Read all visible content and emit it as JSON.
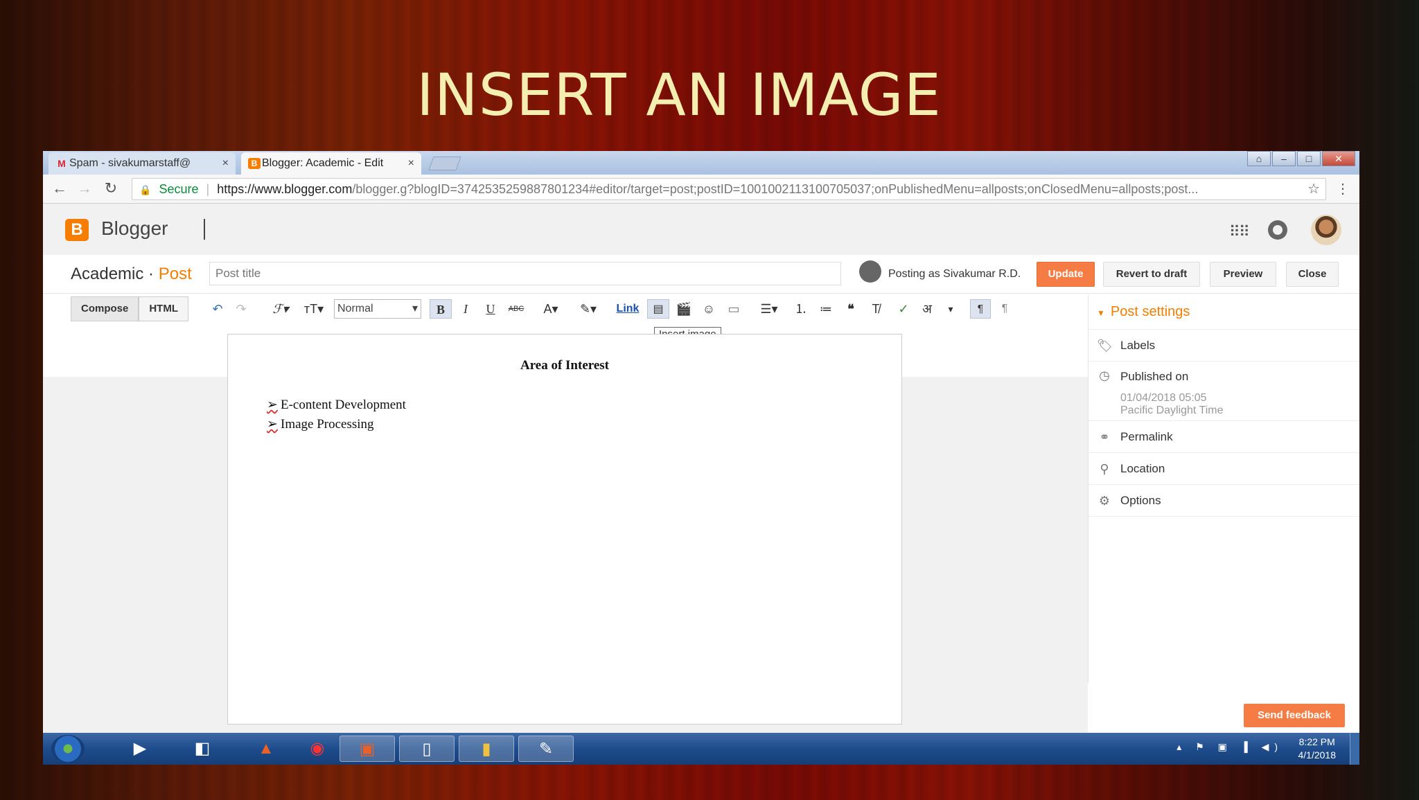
{
  "slide": {
    "title": "INSERT AN IMAGE"
  },
  "browser": {
    "tabs": [
      {
        "label": "Spam - sivakumarstaff@",
        "icon": "gmail-icon"
      },
      {
        "label": "Blogger: Academic - Edit",
        "icon": "blogger-icon"
      }
    ],
    "tab_close": "×",
    "address": {
      "secure_label": "Secure",
      "url_host": "https://www.blogger.com",
      "url_rest": "/blogger.g?blogID=3742535259887801234#editor/target=post;postID=1001002113100705037;onPublishedMenu=allposts;onClosedMenu=allposts;post..."
    }
  },
  "blogger": {
    "brand": "Blogger",
    "logo_letter": "B",
    "crumb_blog": "Academic",
    "crumb_sep": "·",
    "crumb_post": "Post",
    "post_title_placeholder": "Post title",
    "posting_as_prefix": "Posting as",
    "posting_as_name": "Sivakumar R.D.",
    "buttons": {
      "update": "Update",
      "revert": "Revert to draft",
      "preview": "Preview",
      "close": "Close"
    }
  },
  "toolbar": {
    "compose": "Compose",
    "html": "HTML",
    "font_size": "Normal",
    "bold": "B",
    "italic": "I",
    "underline": "U",
    "strike": "ABC",
    "link": "Link",
    "translit": "अ",
    "tooltip": "Insert image"
  },
  "document": {
    "heading": "Area of Interest",
    "items": [
      "E-content Development",
      "Image Processing"
    ]
  },
  "sidebar": {
    "header": "Post settings",
    "labels": "Labels",
    "published_on": "Published on",
    "published_date": "01/04/2018 05:05",
    "published_tz": "Pacific Daylight Time",
    "permalink": "Permalink",
    "location": "Location",
    "options": "Options"
  },
  "feedback": "Send feedback",
  "taskbar": {
    "time": "8:22 PM",
    "date": "4/1/2018"
  },
  "colors": {
    "accent": "#f57d00",
    "update_btn": "#f57d45",
    "title_text": "#f4efb0"
  }
}
